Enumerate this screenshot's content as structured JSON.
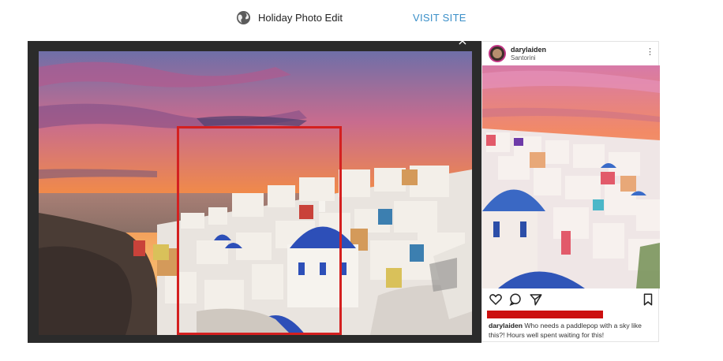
{
  "header": {
    "globe_icon": "globe-icon",
    "title": "Holiday Photo Edit",
    "visit_label": "VISIT SITE",
    "accent_color": "#3a8fc8"
  },
  "viewer": {
    "close_icon": "close-icon",
    "highlight_color": "#d42020"
  },
  "post": {
    "username": "darylaiden",
    "location": "Santorini",
    "more_icon": "more-vertical-icon",
    "actions": [
      "heart-icon",
      "comment-icon",
      "share-icon",
      "bookmark-icon"
    ],
    "caption_user": "darylaiden",
    "caption_text": " Who needs a paddlepop with a sky like this?! Hours well spent waiting for this!"
  }
}
